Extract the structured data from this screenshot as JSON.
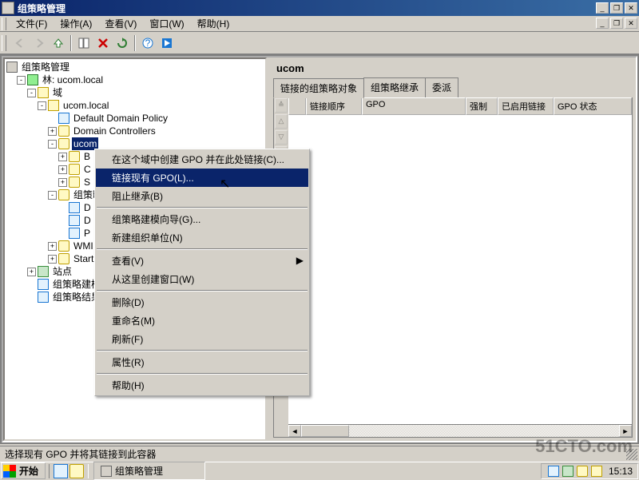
{
  "window": {
    "title": "组策略管理",
    "btn_min": "_",
    "btn_max": "❐",
    "btn_close": "✕"
  },
  "menu": {
    "file": "文件(F)",
    "action": "操作(A)",
    "view": "查看(V)",
    "window": "窗口(W)",
    "help": "帮助(H)"
  },
  "tree": {
    "root": "组策略管理",
    "forest": "林: ucom.local",
    "domains": "域",
    "domain": "ucom.local",
    "ddp": "Default Domain Policy",
    "dc": "Domain Controllers",
    "ucom": "ucom",
    "b": "B",
    "c": "C",
    "s": "S",
    "gpobj": "组策略",
    "d1": "D",
    "d2": "D",
    "p": "P",
    "wmi": "WMI",
    "start": "Start",
    "sites": "站点",
    "model": "组策略建模",
    "result": "组策略结果"
  },
  "ctx": {
    "create": "在这个域中创建 GPO 并在此处链接(C)...",
    "link": "链接现有 GPO(L)...",
    "block": "阻止继承(B)",
    "wizard": "组策略建模向导(G)...",
    "newou": "新建组织单位(N)",
    "view": "查看(V)",
    "window": "从这里创建窗口(W)",
    "delete": "删除(D)",
    "rename": "重命名(M)",
    "refresh": "刷新(F)",
    "props": "属性(R)",
    "help": "帮助(H)"
  },
  "detail": {
    "heading": "ucom",
    "tabs": {
      "linked": "链接的组策略对象",
      "inherit": "组策略继承",
      "delegate": "委派"
    },
    "cols": {
      "order": "链接顺序",
      "gpo": "GPO",
      "enforce": "强制",
      "enabled": "已启用链接",
      "status": "GPO 状态"
    }
  },
  "status": "选择现有 GPO 并将其链接到此容器",
  "taskbar": {
    "start": "开始",
    "task1": "组策略管理",
    "clock": "15:13"
  },
  "watermark": "51CTO.com"
}
